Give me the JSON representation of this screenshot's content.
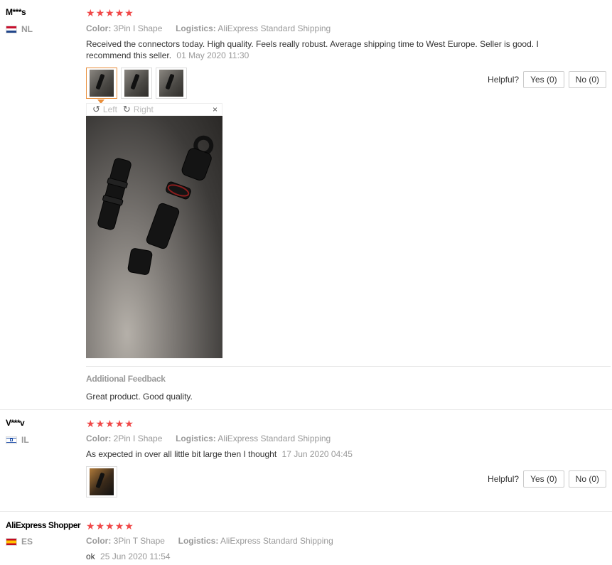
{
  "reviews": [
    {
      "user": "M***s",
      "country": "NL",
      "stars": 5,
      "color_label": "Color:",
      "color_value": "3Pin I Shape",
      "logistics_label": "Logistics:",
      "logistics_value": "AliExpress Standard Shipping",
      "text": "Received the connectors today. High quality. Feels really robust. Average shipping time to West Europe. Seller is good. I recommend this seller.",
      "date": "01 May 2020 11:30",
      "photo_count": 3,
      "viewer": {
        "left": "Left",
        "right": "Right",
        "close": "×"
      },
      "additional_title": "Additional Feedback",
      "additional_text": "Great product. Good quality."
    },
    {
      "user": "V***v",
      "country": "IL",
      "stars": 5,
      "color_label": "Color:",
      "color_value": "2Pin I Shape",
      "logistics_label": "Logistics:",
      "logistics_value": "AliExpress Standard Shipping",
      "text": "As expected in over all little bit large then I thought",
      "date": "17 Jun 2020 04:45",
      "photo_count": 1
    },
    {
      "user": "AliExpress Shopper",
      "country": "ES",
      "stars": 5,
      "color_label": "Color:",
      "color_value": "3Pin T Shape",
      "logistics_label": "Logistics:",
      "logistics_value": "AliExpress Standard Shipping",
      "text": "ok",
      "date": "25 Jun 2020 11:54"
    }
  ],
  "helpful": {
    "label": "Helpful?",
    "yes": "Yes (0)",
    "no": "No (0)"
  },
  "colors": {
    "star": "#f04848",
    "active_thumb": "#e98f3c"
  },
  "icons": {
    "star": "star-icon",
    "rotate_left": "rotate-left-icon",
    "rotate_right": "rotate-right-icon",
    "close": "close-icon"
  }
}
